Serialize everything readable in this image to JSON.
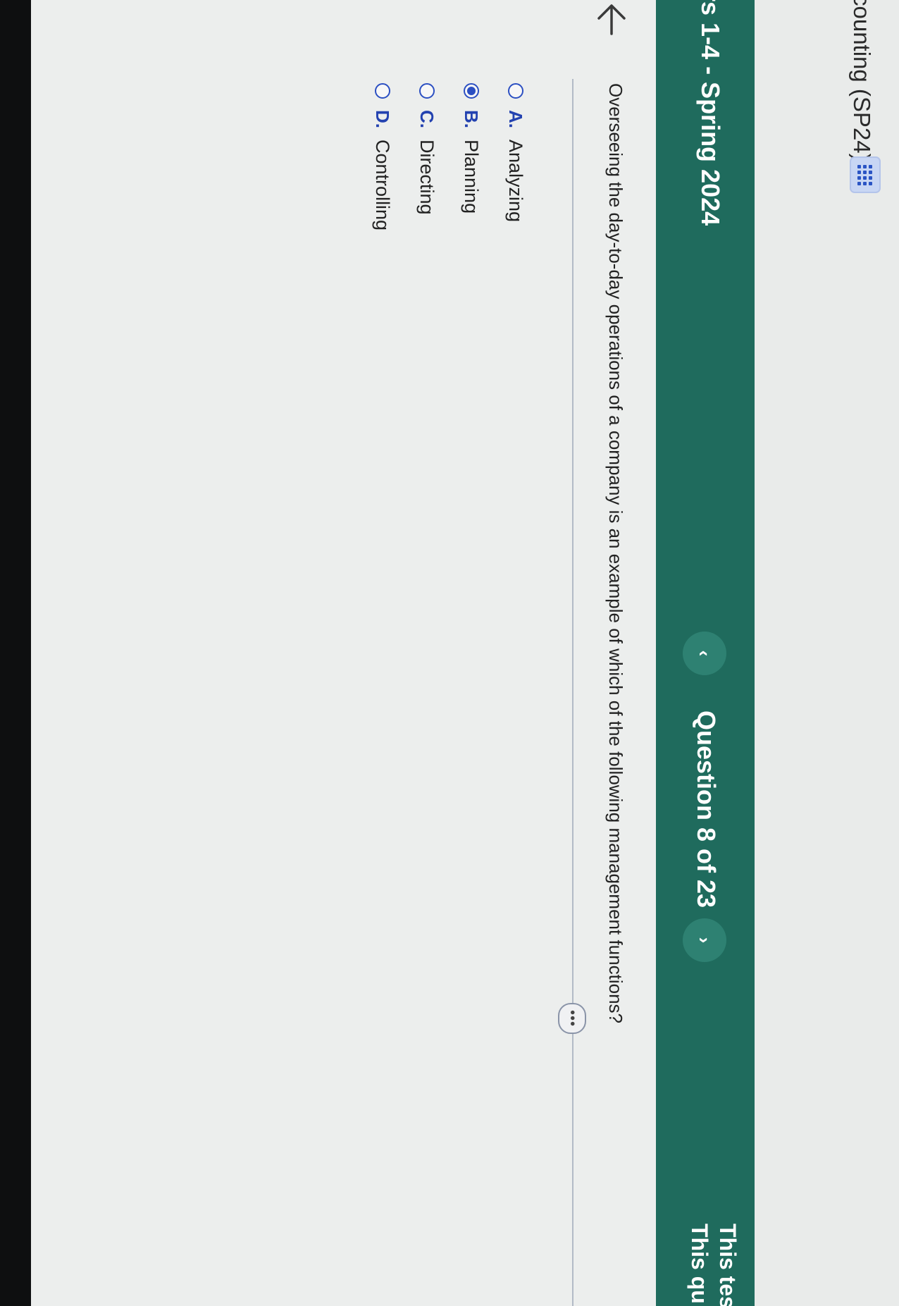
{
  "header": {
    "course_title": "counting (SP24)",
    "grid_icon": "grid-icon"
  },
  "test_bar": {
    "test_title": "rs 1-4 - Spring 2024",
    "prev_symbol": "‹",
    "question_counter": "Question 8 of 23",
    "next_symbol": "›",
    "info_line_1": "This tes",
    "info_line_2": "This qu"
  },
  "question": {
    "text": "Overseeing the day‑to‑day operations of a company is an example of which of the following management functions?",
    "more_label": "•••",
    "selected_letter": "B.",
    "answers": [
      {
        "letter": "A.",
        "text": "Analyzing"
      },
      {
        "letter": "B.",
        "text": "Planning"
      },
      {
        "letter": "C.",
        "text": "Directing"
      },
      {
        "letter": "D.",
        "text": "Controlling"
      }
    ]
  },
  "colors": {
    "brand_green": "#1f6b5d",
    "radio_blue": "#2b4fc2"
  }
}
